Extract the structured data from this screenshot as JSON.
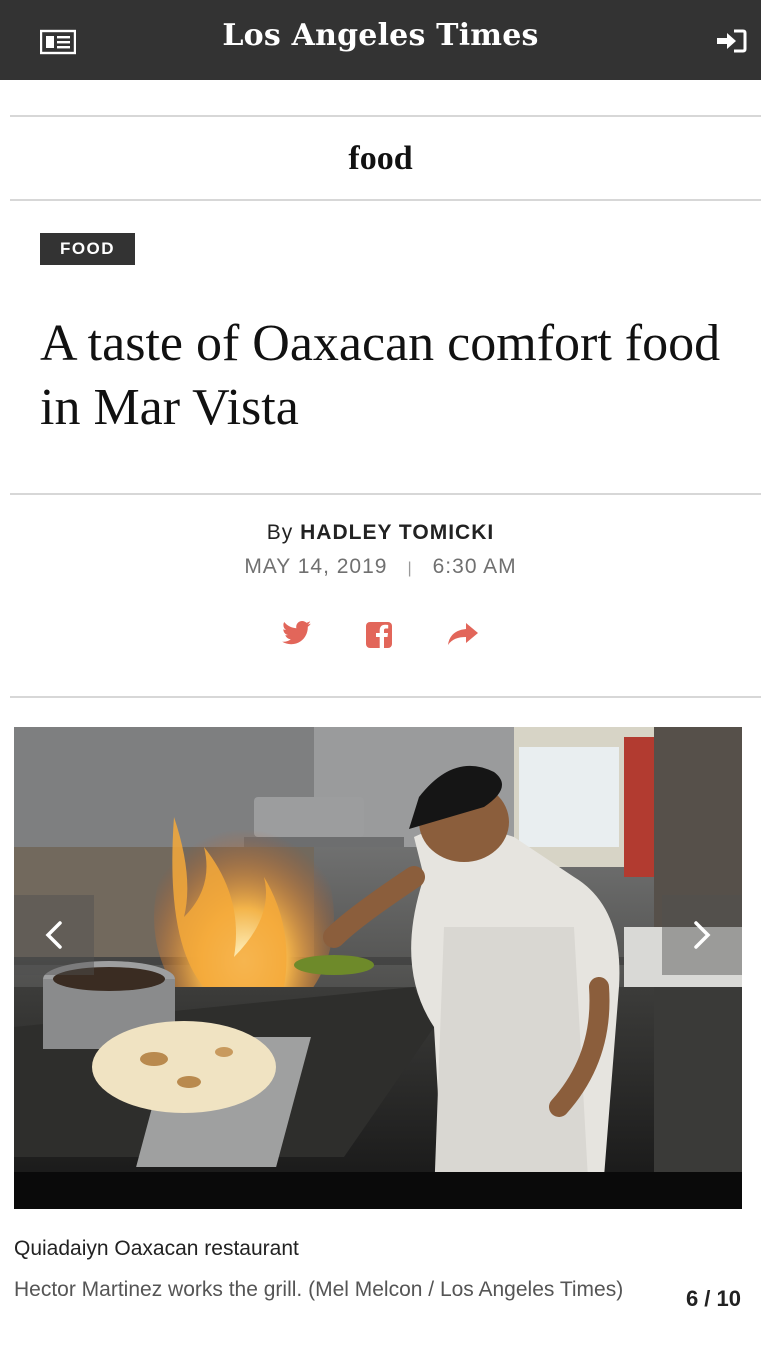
{
  "header": {
    "logo": "Los Angeles Times",
    "menu_icon": "newspaper-menu-icon",
    "login_icon": "sign-in-icon"
  },
  "section": {
    "title": "food"
  },
  "article": {
    "tag": "FOOD",
    "headline": "A taste of Oaxacan comfort food in Mar Vista",
    "byline_prefix": "By",
    "author": "HADLEY TOMICKI",
    "date": "MAY 14, 2019",
    "time": "6:30 AM",
    "separator": "|"
  },
  "share": {
    "icons": [
      "twitter-icon",
      "facebook-icon",
      "share-icon"
    ],
    "color": "#e2665a"
  },
  "gallery": {
    "caption_title": "Quiadaiyn Oaxacan restaurant",
    "caption_text": "Hector Martinez works the grill. (Mel Melcon / Los Angeles Times)",
    "counter": "6 / 10",
    "image_icon": "chef-grilling-photo"
  }
}
